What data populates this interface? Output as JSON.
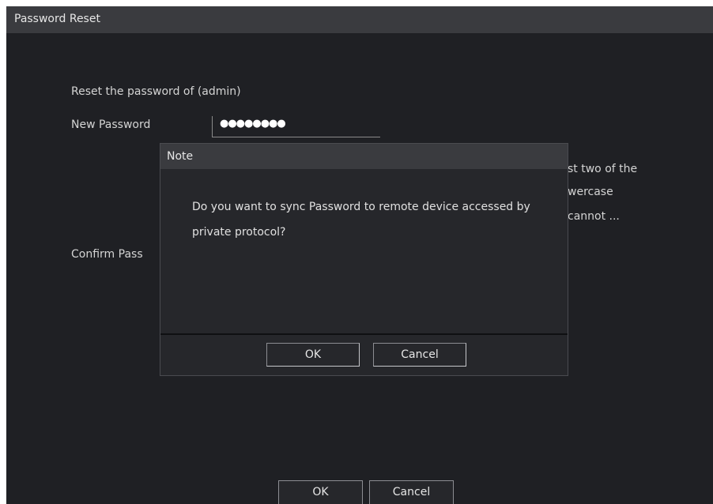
{
  "window": {
    "title": "Password Reset"
  },
  "form": {
    "reset_text": "Reset the password of (admin)",
    "new_password_label": "New Password",
    "new_password_value": "●●●●●●●●",
    "confirm_password_label": "Confirm Pass",
    "hint_line1": "st two of the",
    "hint_line2": "wercase",
    "hint_line3": "cannot ..."
  },
  "dialog": {
    "title": "Note",
    "message": "Do you want to sync Password to remote device accessed by private protocol?",
    "ok_label": "OK",
    "cancel_label": "Cancel"
  },
  "footer": {
    "ok_label": "OK",
    "cancel_label": "Cancel"
  }
}
